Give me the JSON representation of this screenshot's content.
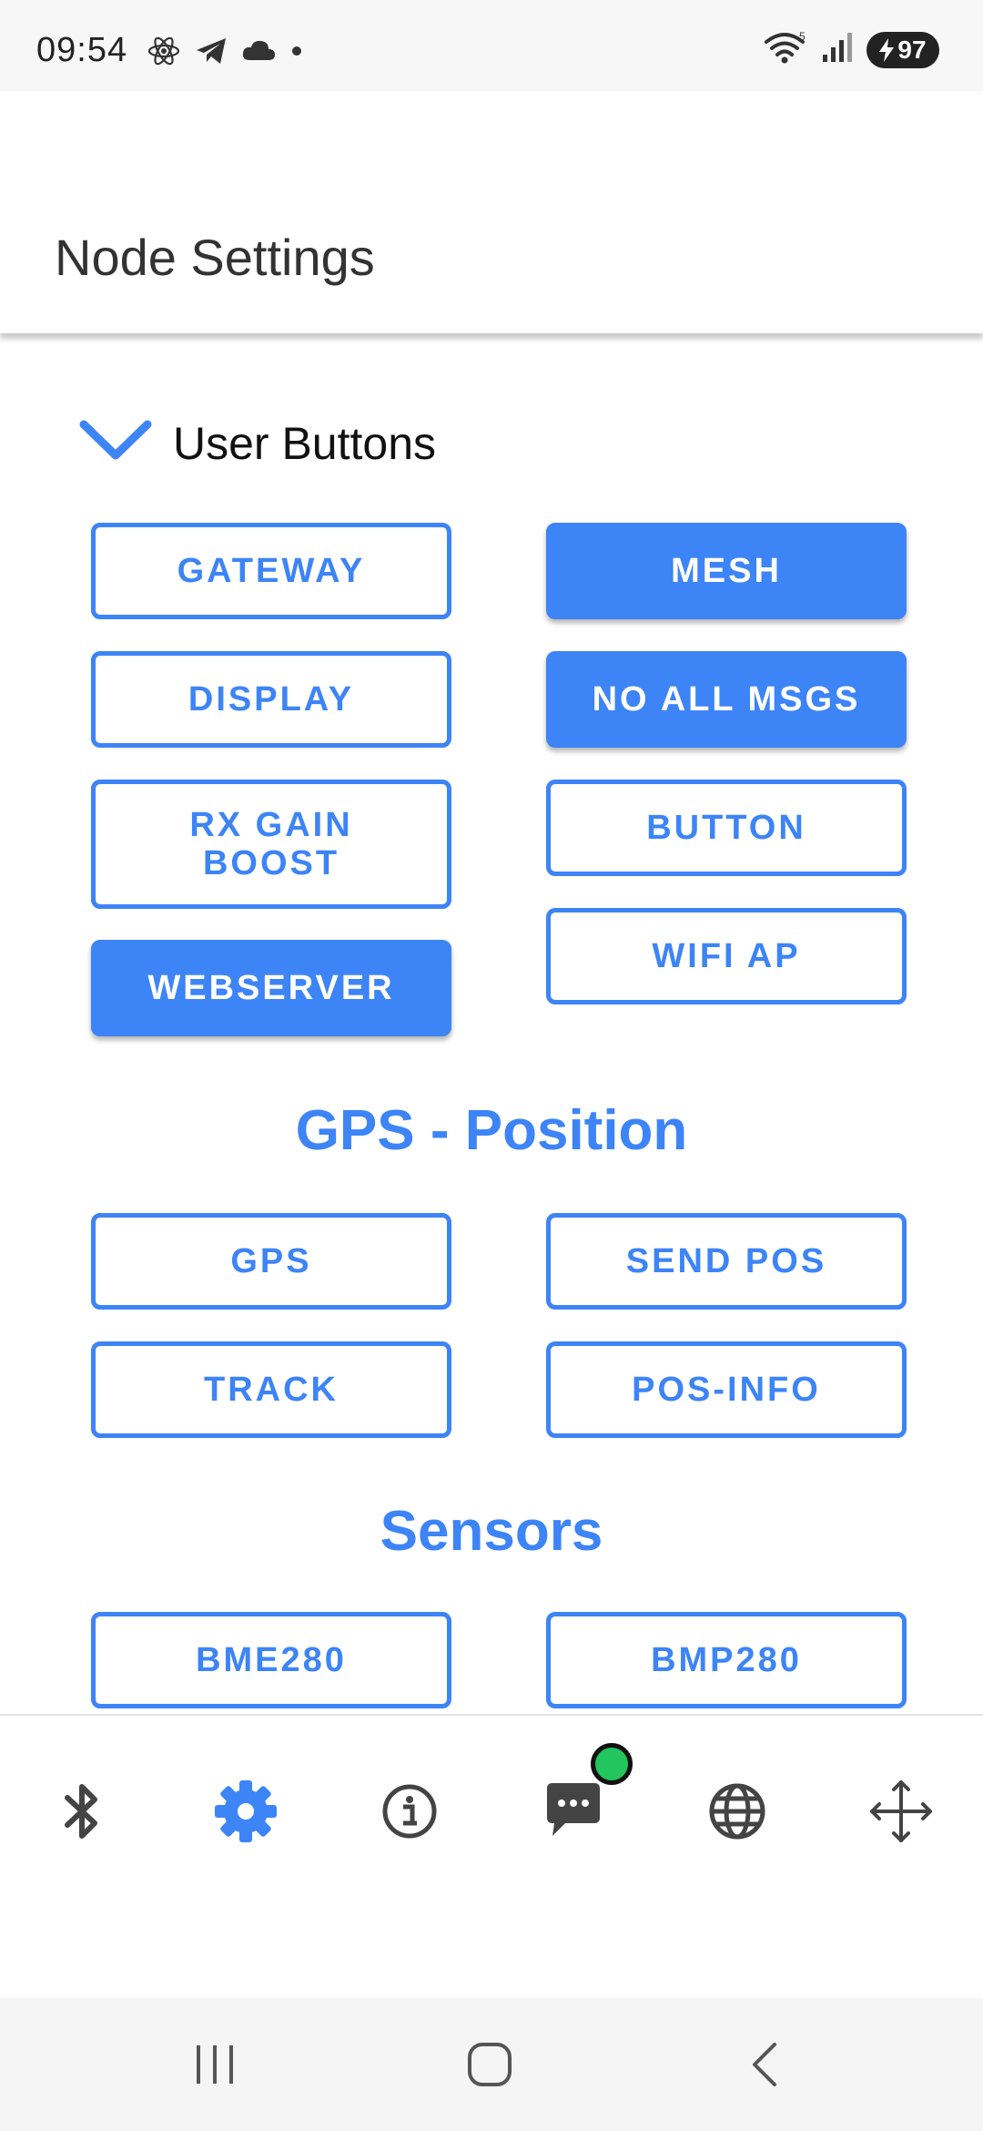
{
  "status_bar": {
    "time": "09:54",
    "battery": "97",
    "icons_left": [
      "react-icon",
      "telegram-icon",
      "cloud-icon",
      "dot-icon"
    ],
    "icons_right": [
      "wifi-icon",
      "signal-icon",
      "battery-icon"
    ]
  },
  "app_bar": {
    "title": "Node Settings"
  },
  "user_buttons": {
    "label": "User Buttons",
    "buttons": [
      {
        "label": "GATEWAY",
        "active": false
      },
      {
        "label": "MESH",
        "active": true
      },
      {
        "label": "DISPLAY",
        "active": false
      },
      {
        "label": "NO ALL MSGS",
        "active": true
      },
      {
        "label": "RX GAIN BOOST",
        "active": false
      },
      {
        "label": "BUTTON",
        "active": false
      },
      {
        "label": "WEBSERVER",
        "active": true
      },
      {
        "label": "WIFI AP",
        "active": false
      }
    ]
  },
  "gps_section": {
    "heading": "GPS - Position",
    "buttons": [
      {
        "label": "GPS",
        "active": false
      },
      {
        "label": "SEND POS",
        "active": false
      },
      {
        "label": "TRACK",
        "active": false
      },
      {
        "label": "POS-INFO",
        "active": false
      }
    ]
  },
  "sensors_section": {
    "heading": "Sensors",
    "buttons": [
      {
        "label": "BME280",
        "active": false
      },
      {
        "label": "BMP280",
        "active": false
      }
    ]
  },
  "bottom_nav": {
    "items": [
      "bluetooth-icon",
      "settings-icon",
      "info-icon",
      "chat-icon",
      "globe-icon",
      "move-icon"
    ],
    "selected": "settings-icon",
    "accent_color": "#3d84f7",
    "badge_color": "#22c55e"
  },
  "colors": {
    "primary": "#3d84f7",
    "text": "#333333"
  }
}
